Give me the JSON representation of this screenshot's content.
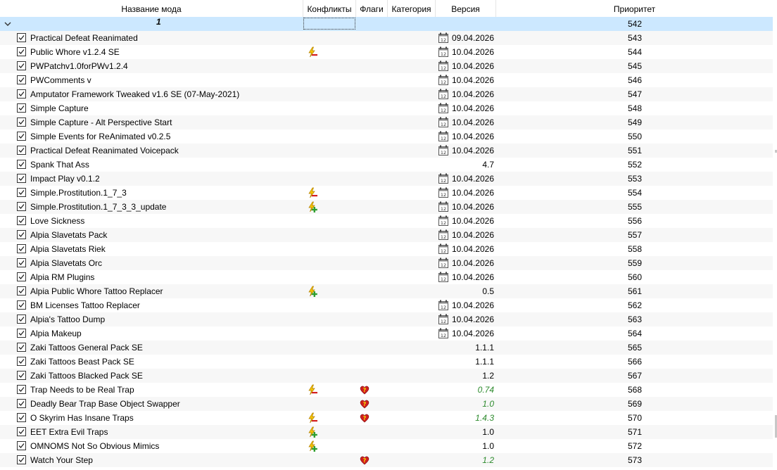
{
  "columns": {
    "name": "Название мода",
    "conflicts": "Конфликты",
    "flags": "Флаги",
    "category": "Категория",
    "version": "Версия",
    "priority": "Приоритет"
  },
  "group": {
    "label": "1",
    "priority": "542"
  },
  "rows": [
    {
      "name": "Practical Defeat Reanimated",
      "conflict": "",
      "flag": "",
      "calendar": true,
      "version": "09.04.2026",
      "priority": "543",
      "green": false
    },
    {
      "name": "Public Whore v1.2.4 SE",
      "conflict": "overwritten",
      "flag": "",
      "calendar": true,
      "version": "10.04.2026",
      "priority": "544",
      "green": false
    },
    {
      "name": "PWPatchv1.0forPWv1.2.4",
      "conflict": "",
      "flag": "",
      "calendar": true,
      "version": "10.04.2026",
      "priority": "545",
      "green": false
    },
    {
      "name": "PWComments v",
      "conflict": "",
      "flag": "",
      "calendar": true,
      "version": "10.04.2026",
      "priority": "546",
      "green": false
    },
    {
      "name": "Amputator Framework Tweaked v1.6 SE (07-May-2021)",
      "conflict": "",
      "flag": "",
      "calendar": true,
      "version": "10.04.2026",
      "priority": "547",
      "green": false
    },
    {
      "name": "Simple Capture",
      "conflict": "",
      "flag": "",
      "calendar": true,
      "version": "10.04.2026",
      "priority": "548",
      "green": false
    },
    {
      "name": "Simple Capture - Alt Perspective Start",
      "conflict": "",
      "flag": "",
      "calendar": true,
      "version": "10.04.2026",
      "priority": "549",
      "green": false
    },
    {
      "name": "Simple Events for ReAnimated v0.2.5",
      "conflict": "",
      "flag": "",
      "calendar": true,
      "version": "10.04.2026",
      "priority": "550",
      "green": false
    },
    {
      "name": "Practical Defeat Reanimated Voicepack",
      "conflict": "",
      "flag": "",
      "calendar": true,
      "version": "10.04.2026",
      "priority": "551",
      "green": false
    },
    {
      "name": "Spank That Ass",
      "conflict": "",
      "flag": "",
      "calendar": false,
      "version": "4.7",
      "priority": "552",
      "green": false
    },
    {
      "name": "Impact Play v0.1.2",
      "conflict": "",
      "flag": "",
      "calendar": true,
      "version": "10.04.2026",
      "priority": "553",
      "green": false
    },
    {
      "name": "Simple.Prostitution.1_7_3",
      "conflict": "overwritten",
      "flag": "",
      "calendar": true,
      "version": "10.04.2026",
      "priority": "554",
      "green": false
    },
    {
      "name": "Simple.Prostitution.1_7_3_3_update",
      "conflict": "overwrite",
      "flag": "",
      "calendar": true,
      "version": "10.04.2026",
      "priority": "555",
      "green": false
    },
    {
      "name": "Love Sickness",
      "conflict": "",
      "flag": "",
      "calendar": true,
      "version": "10.04.2026",
      "priority": "556",
      "green": false
    },
    {
      "name": "Alpia Slavetats Pack",
      "conflict": "",
      "flag": "",
      "calendar": true,
      "version": "10.04.2026",
      "priority": "557",
      "green": false
    },
    {
      "name": "Alpia Slavetats Riek",
      "conflict": "",
      "flag": "",
      "calendar": true,
      "version": "10.04.2026",
      "priority": "558",
      "green": false
    },
    {
      "name": "Alpia Slavetats Orc",
      "conflict": "",
      "flag": "",
      "calendar": true,
      "version": "10.04.2026",
      "priority": "559",
      "green": false
    },
    {
      "name": "Alpia RM Plugins",
      "conflict": "",
      "flag": "",
      "calendar": true,
      "version": "10.04.2026",
      "priority": "560",
      "green": false
    },
    {
      "name": "Alpia Public Whore Tattoo Replacer",
      "conflict": "overwrite",
      "flag": "",
      "calendar": false,
      "version": "0.5",
      "priority": "561",
      "green": false
    },
    {
      "name": "BM Licenses Tattoo Replacer",
      "conflict": "",
      "flag": "",
      "calendar": true,
      "version": "10.04.2026",
      "priority": "562",
      "green": false
    },
    {
      "name": "Alpia's Tattoo Dump",
      "conflict": "",
      "flag": "",
      "calendar": true,
      "version": "10.04.2026",
      "priority": "563",
      "green": false
    },
    {
      "name": "Alpia Makeup",
      "conflict": "",
      "flag": "",
      "calendar": true,
      "version": "10.04.2026",
      "priority": "564",
      "green": false
    },
    {
      "name": "Zaki Tattoos General Pack SE",
      "conflict": "",
      "flag": "",
      "calendar": false,
      "version": "1.1.1",
      "priority": "565",
      "green": false
    },
    {
      "name": "Zaki Tattoos Beast Pack SE",
      "conflict": "",
      "flag": "",
      "calendar": false,
      "version": "1.1.1",
      "priority": "566",
      "green": false
    },
    {
      "name": "Zaki Tattoos Blacked Pack SE",
      "conflict": "",
      "flag": "",
      "calendar": false,
      "version": "1.2",
      "priority": "567",
      "green": false
    },
    {
      "name": "Trap Needs to be Real Trap",
      "conflict": "overwritten",
      "flag": "heart",
      "calendar": false,
      "version": "0.74",
      "priority": "568",
      "green": true
    },
    {
      "name": "Deadly Bear Trap Base Object Swapper",
      "conflict": "",
      "flag": "heart",
      "calendar": false,
      "version": "1.0",
      "priority": "569",
      "green": true
    },
    {
      "name": "O Skyrim Has Insane Traps",
      "conflict": "overwritten",
      "flag": "heart",
      "calendar": false,
      "version": "1.4.3",
      "priority": "570",
      "green": true
    },
    {
      "name": "EET Extra Evil Traps",
      "conflict": "overwrite",
      "flag": "",
      "calendar": false,
      "version": "1.0",
      "priority": "571",
      "green": false
    },
    {
      "name": "OMNOMS Not So Obvious Mimics",
      "conflict": "overwrite",
      "flag": "",
      "calendar": false,
      "version": "1.0",
      "priority": "572",
      "green": false
    },
    {
      "name": "Watch Your Step",
      "conflict": "",
      "flag": "heart",
      "calendar": false,
      "version": "1.2",
      "priority": "573",
      "green": true
    }
  ]
}
